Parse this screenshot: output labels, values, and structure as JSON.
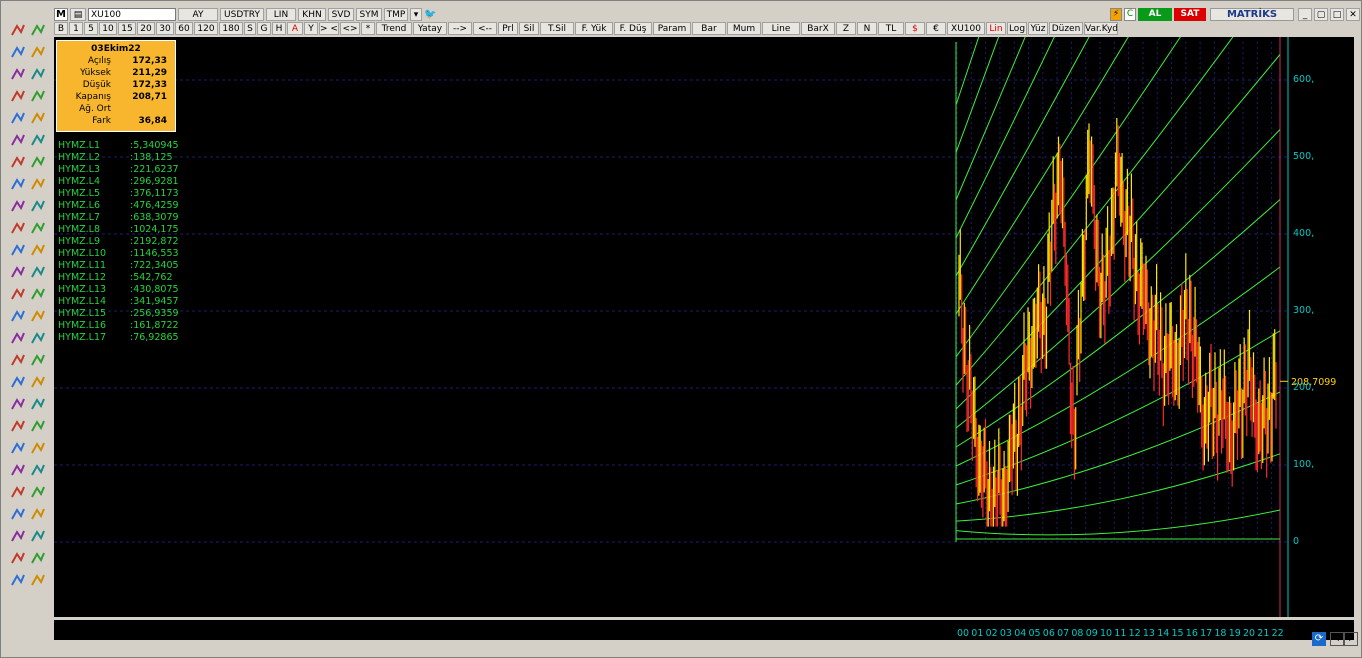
{
  "toolbar": {
    "logo": "M",
    "symbol": "XU100",
    "period": "AY",
    "currency": "USDTRY",
    "scale_lin": "LIN",
    "buttons_row1": [
      "KHN",
      "SVD",
      "SYM",
      "TMP"
    ],
    "buttons_row2": [
      "B",
      "1",
      "5",
      "10",
      "15",
      "20",
      "30",
      "60",
      "120",
      "180",
      "S",
      "G",
      "H",
      "A",
      "Y"
    ],
    "nav_row2": [
      "> <",
      "<>",
      "*",
      "Trend",
      "Yatay",
      "-->",
      "<--",
      "Prl",
      "Sil",
      "T.Sil",
      "F. Yük",
      "F. Düş",
      "Param",
      "Bar",
      "Mum",
      "Line",
      "BarX",
      "Z",
      "N",
      "TL",
      "$",
      "€",
      "XU100",
      "Lin",
      "Log",
      "Yüz",
      "Düzen",
      "Var.Kyd"
    ],
    "buy_label": "AL",
    "sell_label": "SAT",
    "brand": "MATRİKS"
  },
  "info": {
    "date": "03Ekim22",
    "rows": [
      {
        "k": "Açılış",
        "v": "172,33"
      },
      {
        "k": "Yüksek",
        "v": "211,29"
      },
      {
        "k": "Düşük",
        "v": "172,33"
      },
      {
        "k": "Kapanış",
        "v": "208,71"
      },
      {
        "k": "Ağ. Ort",
        "v": ""
      },
      {
        "k": "Fark",
        "v": "36,84"
      }
    ]
  },
  "levels": [
    {
      "name": "HYMZ.L1",
      "value": ":5,340945"
    },
    {
      "name": "HYMZ.L2",
      "value": ":138,125"
    },
    {
      "name": "HYMZ.L3",
      "value": ":221,6237"
    },
    {
      "name": "HYMZ.L4",
      "value": ":296,9281"
    },
    {
      "name": "HYMZ.L5",
      "value": ":376,1173"
    },
    {
      "name": "HYMZ.L6",
      "value": ":476,4259"
    },
    {
      "name": "HYMZ.L7",
      "value": ":638,3079"
    },
    {
      "name": "HYMZ.L8",
      "value": ":1024,175"
    },
    {
      "name": "HYMZ.L9",
      "value": ":2192,872"
    },
    {
      "name": "HYMZ.L10",
      "value": ":1146,553"
    },
    {
      "name": "HYMZ.L11",
      "value": ":722,3405"
    },
    {
      "name": "HYMZ.L12",
      "value": ":542,762"
    },
    {
      "name": "HYMZ.L13",
      "value": ":430,8075"
    },
    {
      "name": "HYMZ.L14",
      "value": ":341,9457"
    },
    {
      "name": "HYMZ.L15",
      "value": ":256,9359"
    },
    {
      "name": "HYMZ.L16",
      "value": ":161,8722"
    },
    {
      "name": "HYMZ.L17",
      "value": ":76,92865"
    }
  ],
  "last_price": "208,7099",
  "chart_data": {
    "type": "line",
    "ylim": [
      0,
      650
    ],
    "yticks": [
      "0",
      "100,",
      "200,",
      "300,",
      "400,",
      "500,",
      "600,"
    ],
    "xticks": [
      "00",
      "01",
      "02",
      "03",
      "04",
      "05",
      "06",
      "07",
      "08",
      "09",
      "10",
      "11",
      "12",
      "13",
      "14",
      "15",
      "16",
      "17",
      "18",
      "19",
      "20",
      "21",
      "22"
    ],
    "series": [
      {
        "x": [
          "00",
          "01",
          "02",
          "03",
          "04",
          "05",
          "06",
          "07",
          "08",
          "09",
          "10",
          "11",
          "12",
          "13",
          "14",
          "15",
          "16",
          "17",
          "18",
          "19",
          "20",
          "21",
          "22"
        ],
        "values": [
          330,
          150,
          60,
          55,
          140,
          260,
          300,
          500,
          130,
          500,
          300,
          480,
          380,
          300,
          250,
          230,
          300,
          160,
          180,
          140,
          220,
          140,
          208
        ]
      }
    ],
    "colors": {
      "candles": "#ffe600",
      "bear": "#ff2a2a",
      "bands": "#3cf03c",
      "axis": "#00c8c8",
      "grid": "#1d1d6e"
    }
  }
}
